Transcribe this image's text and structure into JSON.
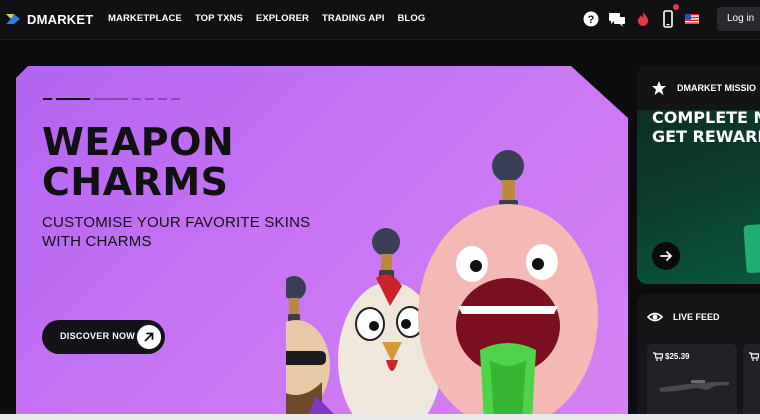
{
  "brand": {
    "name": "DMARKET",
    "accent": "#f6c343"
  },
  "nav": {
    "items": [
      {
        "label": "MARKETPLACE"
      },
      {
        "label": "TOP TXNS"
      },
      {
        "label": "EXPLORER"
      },
      {
        "label": "TRADING API"
      },
      {
        "label": "BLOG"
      }
    ]
  },
  "header_icons": [
    "help-icon",
    "chat-icon",
    "fire-icon",
    "mobile-icon",
    "us-flag-icon"
  ],
  "login": {
    "label": "Log in"
  },
  "hero": {
    "title_line1": "WEAPON",
    "title_line2": "CHARMS",
    "subtitle_line1": "CUSTOMISE YOUR FAVORITE SKINS",
    "subtitle_line2": "WITH CHARMS",
    "cta_label": "DISCOVER NOW",
    "background": "#c774f4"
  },
  "mission_card": {
    "label": "DMARKET MISSIO",
    "title_line1": "COMPLETE M",
    "title_line2": "GET REWARD",
    "accent": "#1fae72"
  },
  "live_feed": {
    "label": "LIVE FEED",
    "items": [
      {
        "price": "$25.39"
      }
    ]
  }
}
